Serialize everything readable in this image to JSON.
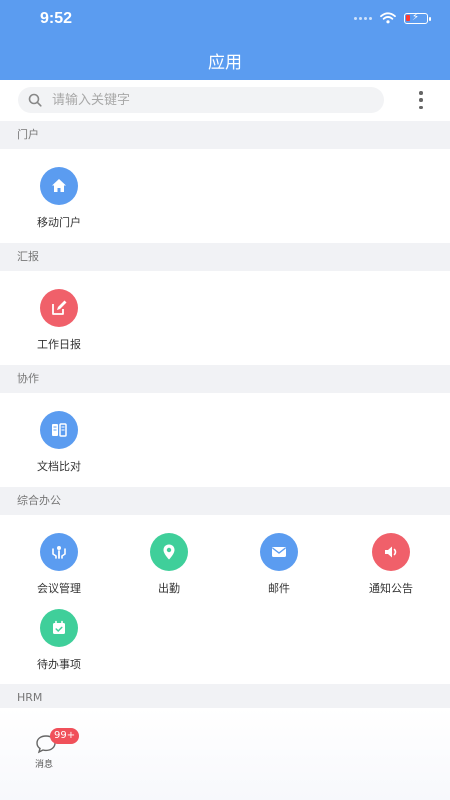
{
  "status_bar": {
    "time": "9:52"
  },
  "header": {
    "title": "应用"
  },
  "search": {
    "placeholder": "请输入关键字"
  },
  "sections": [
    {
      "title": "门户",
      "items": [
        {
          "label": "移动门户",
          "icon": "home-icon",
          "color": "#5b9cf0"
        }
      ]
    },
    {
      "title": "汇报",
      "items": [
        {
          "label": "工作日报",
          "icon": "edit-icon",
          "color": "#f0606a"
        }
      ]
    },
    {
      "title": "协作",
      "items": [
        {
          "label": "文档比对",
          "icon": "document-compare-icon",
          "color": "#5b9cf0"
        }
      ]
    },
    {
      "title": "综合办公",
      "items": [
        {
          "label": "会议管理",
          "icon": "meeting-icon",
          "color": "#5b9cf0"
        },
        {
          "label": "出勤",
          "icon": "location-icon",
          "color": "#3fcf9a"
        },
        {
          "label": "邮件",
          "icon": "mail-icon",
          "color": "#5b9cf0"
        },
        {
          "label": "通知公告",
          "icon": "speaker-icon",
          "color": "#f0606a"
        },
        {
          "label": "待办事项",
          "icon": "calendar-check-icon",
          "color": "#3fcf9a"
        }
      ]
    },
    {
      "title": "HRM",
      "items": []
    }
  ],
  "bottom_bar": {
    "message_label": "消息",
    "badge": "99+"
  },
  "colors": {
    "header": "#5b9cf0",
    "section_bg": "#f1f2f5",
    "badge": "#f0505a"
  }
}
